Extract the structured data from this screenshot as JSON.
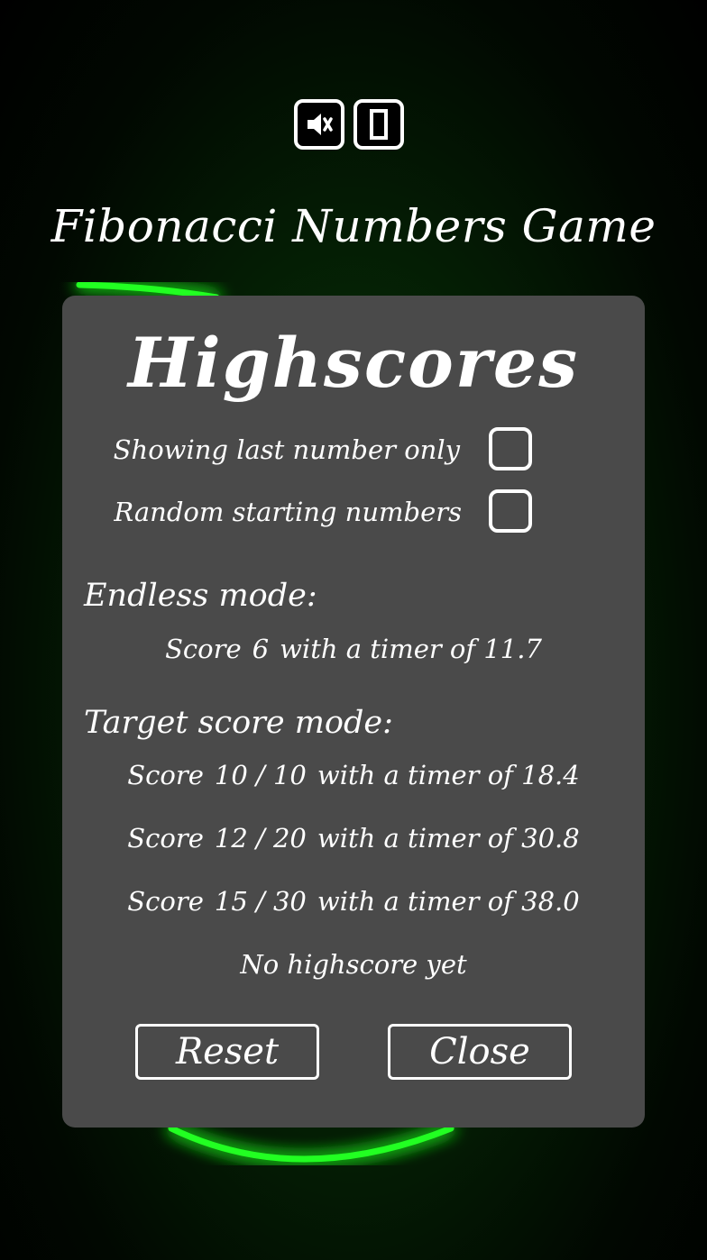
{
  "game": {
    "title": "Fibonacci Numbers Game",
    "accent_color": "#22ff22",
    "controls": [
      {
        "name": "sound-toggle",
        "icon": "speaker-muted-icon"
      },
      {
        "name": "orientation-toggle",
        "icon": "phone-portrait-icon"
      }
    ]
  },
  "highscores": {
    "title": "Highscores",
    "options": [
      {
        "label": "Showing last number only",
        "checked": false
      },
      {
        "label": "Random starting numbers",
        "checked": false
      }
    ],
    "endless": {
      "heading": "Endless mode:",
      "entry": {
        "score_word": "Score",
        "score": "6",
        "timer_text": "with a timer of 11.7"
      }
    },
    "target": {
      "heading": "Target score mode:",
      "entries": [
        {
          "score_word": "Score",
          "score": "10 / 10",
          "timer_text": "with a timer of 18.4"
        },
        {
          "score_word": "Score",
          "score": "12 / 20",
          "timer_text": "with a timer of 30.8"
        },
        {
          "score_word": "Score",
          "score": "15 / 30",
          "timer_text": "with a timer of 38.0"
        }
      ],
      "no_score_text": "No highscore yet"
    },
    "buttons": {
      "reset": "Reset",
      "close": "Close"
    }
  }
}
